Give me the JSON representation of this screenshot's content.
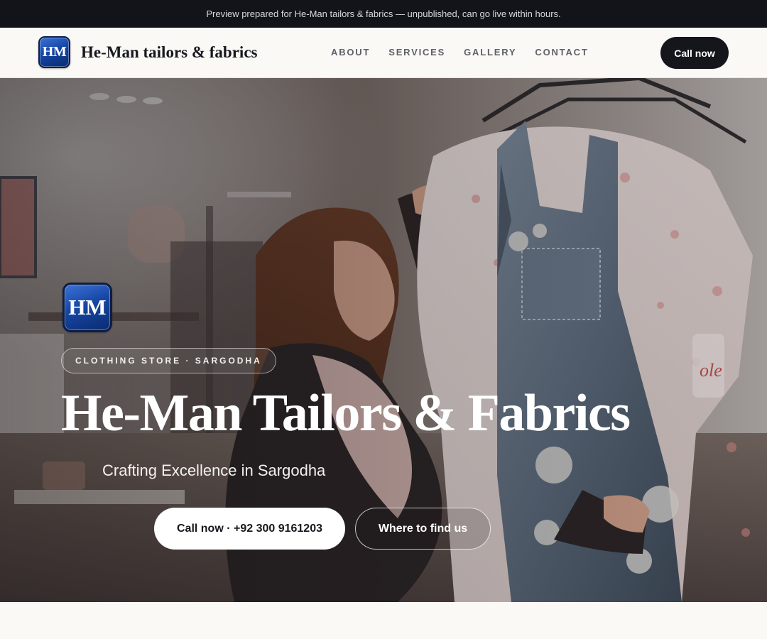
{
  "preview_banner": "Preview prepared for He-Man tailors & fabrics — unpublished, can go live within hours.",
  "brand": {
    "logo_text": "HM",
    "name": "He-Man tailors & fabrics"
  },
  "nav": {
    "links": [
      "ABOUT",
      "SERVICES",
      "GALLERY",
      "CONTACT"
    ],
    "cta_label": "Call now"
  },
  "hero": {
    "logo_text": "HM",
    "eyebrow": "CLOTHING STORE · SARGODHA",
    "title": "He-Man Tailors & Fabrics",
    "subtitle": "Crafting Excellence in Sargodha",
    "primary_cta": "Call now · +92 300 9161203",
    "secondary_cta": "Where to find us"
  },
  "colors": {
    "dark": "#12141a",
    "page_background": "#faf9f6",
    "logo_blue": "#1646a5"
  }
}
